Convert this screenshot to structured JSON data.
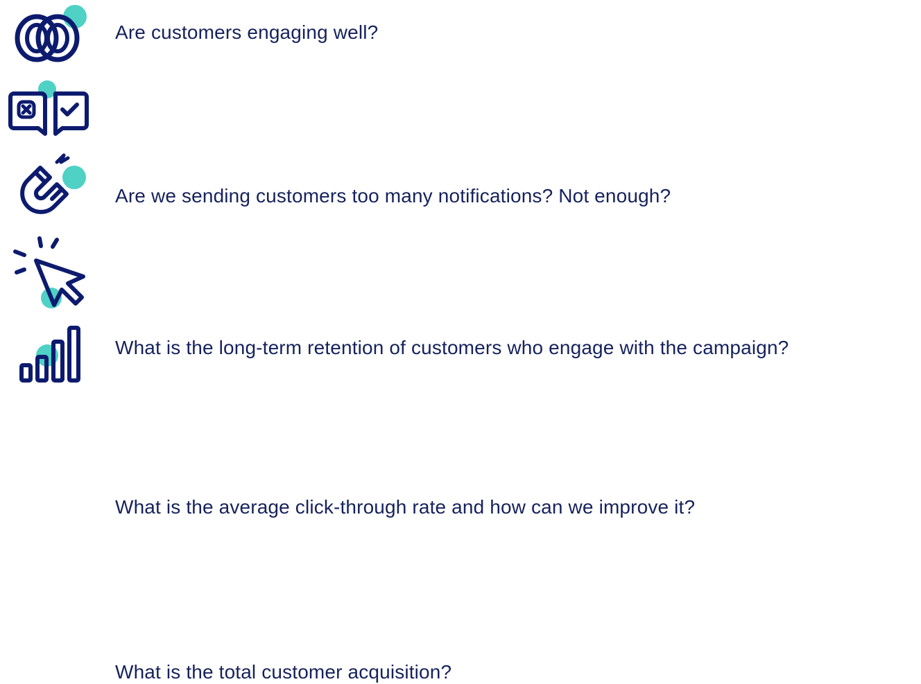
{
  "colors": {
    "icon_stroke": "#0d1b6e",
    "accent_dot": "#4fd1c5",
    "text": "#16225c"
  },
  "items": [
    {
      "icon": "linked-rings-icon",
      "text": "Are customers engaging well?"
    },
    {
      "icon": "chat-reject-accept-icon",
      "text": "Are we sending customers too many notifications? Not enough?"
    },
    {
      "icon": "magnet-icon",
      "text": "What is the long-term retention of customers who engage with the campaign?"
    },
    {
      "icon": "cursor-click-icon",
      "text": "What is the average click-through rate and how can we improve it?"
    },
    {
      "icon": "bar-chart-icon",
      "text": "What is the total customer acquisition?"
    }
  ]
}
